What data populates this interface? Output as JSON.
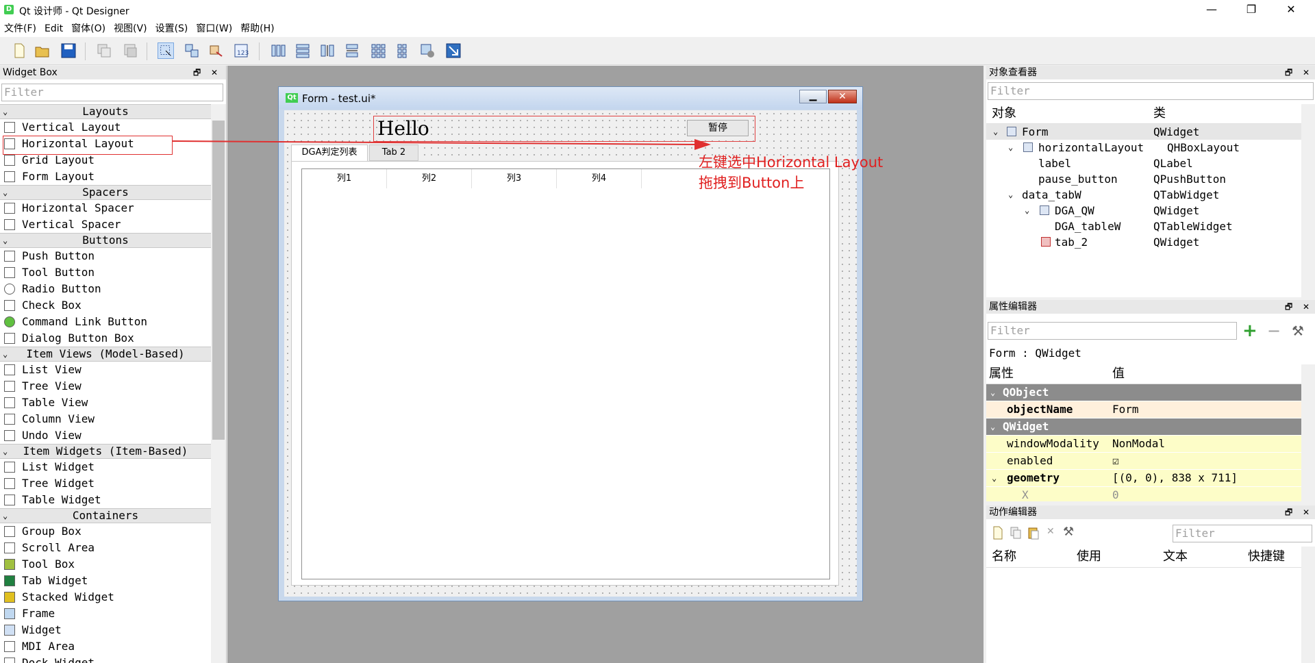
{
  "window": {
    "title": "Qt 设计师 - Qt Designer",
    "icon": "D",
    "controls": [
      "—",
      "❐",
      "✕"
    ]
  },
  "menu": [
    "文件(F)",
    "Edit",
    "窗体(O)",
    "视图(V)",
    "设置(S)",
    "窗口(W)",
    "帮助(H)"
  ],
  "widget_box": {
    "title": "Widget Box",
    "filter_placeholder": "Filter",
    "sections": [
      {
        "name": "Layouts",
        "items": [
          "Vertical Layout",
          "Horizontal Layout",
          "Grid Layout",
          "Form Layout"
        ]
      },
      {
        "name": "Spacers",
        "items": [
          "Horizontal Spacer",
          "Vertical Spacer"
        ]
      },
      {
        "name": "Buttons",
        "items": [
          "Push Button",
          "Tool Button",
          "Radio Button",
          "Check Box",
          "Command Link Button",
          "Dialog Button Box"
        ]
      },
      {
        "name": "Item Views (Model-Based)",
        "items": [
          "List View",
          "Tree View",
          "Table View",
          "Column View",
          "Undo View"
        ]
      },
      {
        "name": "Item Widgets (Item-Based)",
        "items": [
          "List Widget",
          "Tree Widget",
          "Table Widget"
        ]
      },
      {
        "name": "Containers",
        "items": [
          "Group Box",
          "Scroll Area",
          "Tool Box",
          "Tab Widget",
          "Stacked Widget",
          "Frame",
          "Widget",
          "MDI Area",
          "Dock Widget"
        ]
      }
    ]
  },
  "form": {
    "title": "Form - test.ui*",
    "icon_text": "Qt",
    "label_text": "Hello",
    "button_text": "暂停",
    "tabs": [
      "DGA判定列表",
      "Tab 2"
    ],
    "columns": [
      "列1",
      "列2",
      "列3",
      "列4"
    ]
  },
  "annotation": {
    "line1": "左键选中Horizontal Layout",
    "line2": "拖拽到Button上",
    "color": "#e02020"
  },
  "object_inspector": {
    "title": "对象查看器",
    "filter_placeholder": "Filter",
    "headers": [
      "对象",
      "类"
    ],
    "rows": [
      {
        "name": "Form",
        "class": "QWidget"
      },
      {
        "name": "horizontalLayout",
        "class": "QHBoxLayout"
      },
      {
        "name": "label",
        "class": "QLabel"
      },
      {
        "name": "pause_button",
        "class": "QPushButton"
      },
      {
        "name": "data_tabW",
        "class": "QTabWidget"
      },
      {
        "name": "DGA_QW",
        "class": "QWidget"
      },
      {
        "name": "DGA_tableW",
        "class": "QTableWidget"
      },
      {
        "name": "tab_2",
        "class": "QWidget"
      }
    ]
  },
  "property_editor": {
    "title": "属性编辑器",
    "filter_placeholder": "Filter",
    "context": "Form : QWidget",
    "headers": [
      "属性",
      "值"
    ],
    "groups": [
      {
        "name": "QObject",
        "props": [
          {
            "key": "objectName",
            "value": "Form"
          }
        ]
      },
      {
        "name": "QWidget",
        "props": [
          {
            "key": "windowModality",
            "value": "NonModal"
          },
          {
            "key": "enabled",
            "value": "☑"
          },
          {
            "key": "geometry",
            "value": "[(0, 0), 838 x 711]"
          },
          {
            "key": "X",
            "value": "0"
          }
        ]
      }
    ]
  },
  "action_editor": {
    "title": "动作编辑器",
    "filter_placeholder": "Filter",
    "headers": [
      "名称",
      "使用",
      "文本",
      "快捷键"
    ]
  },
  "dock_controls": {
    "float": "🗗",
    "close": "✕"
  },
  "colors": {
    "accent_red": "#e03030",
    "qt_green": "#41cd52",
    "group_gray": "#8c8c8c",
    "prop_yellow": "#fdfdc8"
  }
}
